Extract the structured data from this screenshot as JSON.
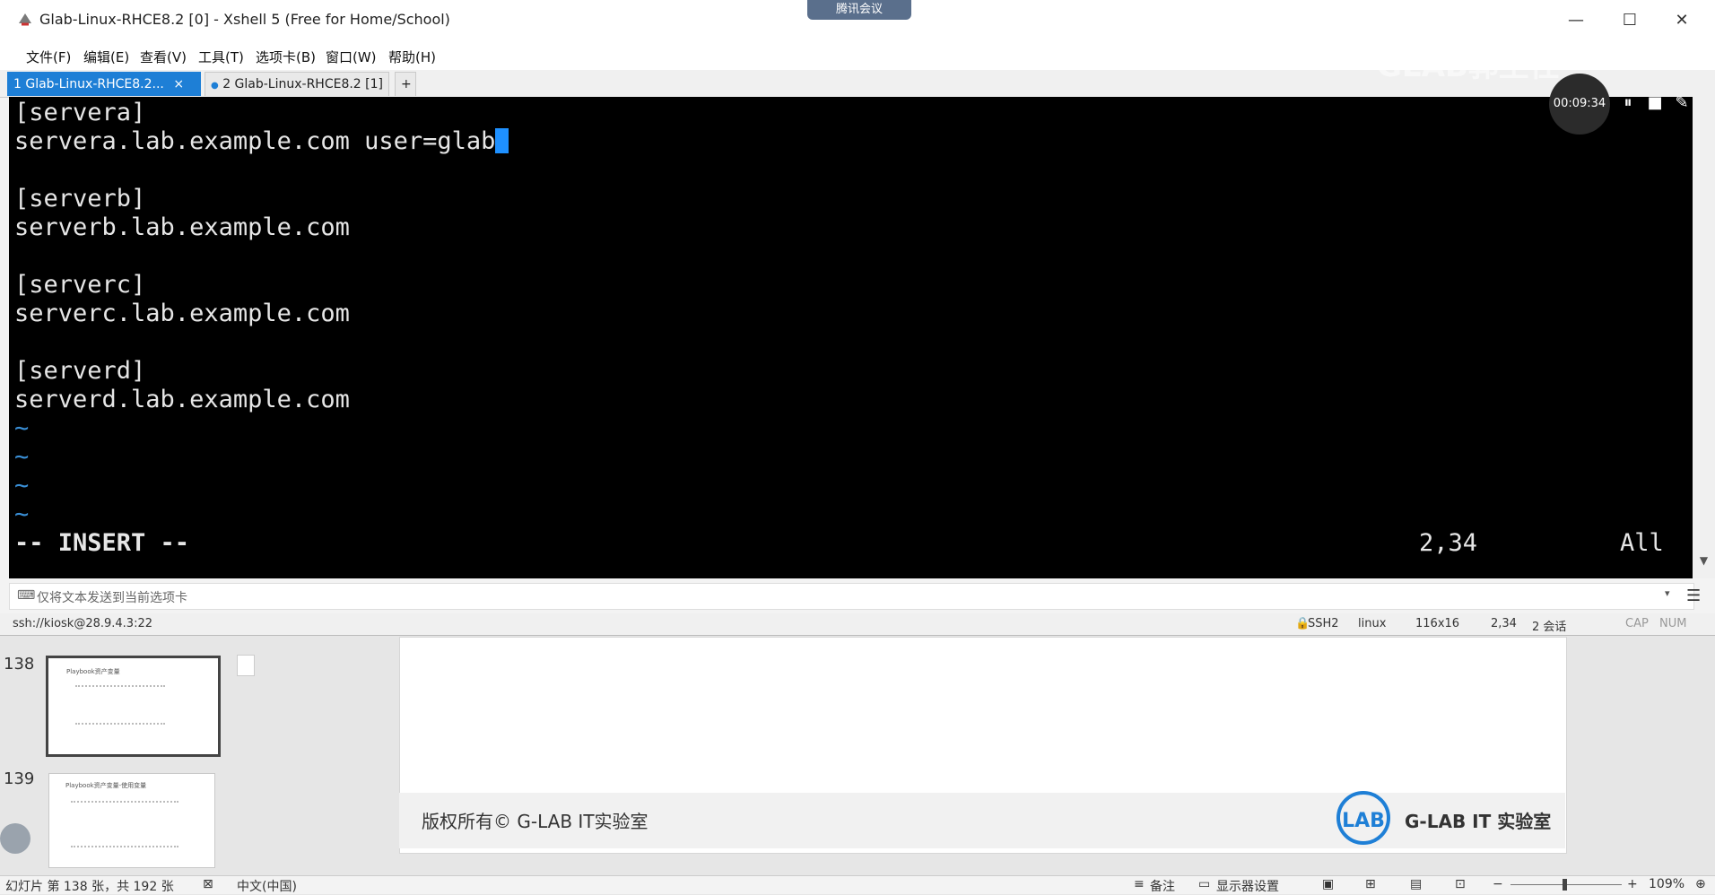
{
  "window": {
    "title": "Glab-Linux-RHCE8.2 [0] - Xshell 5 (Free for Home/School)",
    "meeting_label": "腾讯会议",
    "minimize": "—",
    "maximize": "☐",
    "close": "✕"
  },
  "menu": [
    "文件(F)",
    "编辑(E)",
    "查看(V)",
    "工具(T)",
    "选项卡(B)",
    "窗口(W)",
    "帮助(H)"
  ],
  "tabs": [
    {
      "label": "1 Glab-Linux-RHCE8.2...",
      "close": "×",
      "active": true
    },
    {
      "label": "2 Glab-Linux-RHCE8.2 [1]",
      "close": "×",
      "active": false
    }
  ],
  "new_tab": "+",
  "terminal": {
    "lines": [
      "[servera]",
      "servera.lab.example.com user=glab",
      "",
      "[serverb]",
      "serverb.lab.example.com",
      "",
      "[serverc]",
      "serverc.lab.example.com",
      "",
      "[serverd]",
      "serverd.lab.example.com"
    ],
    "tildes": [
      "~",
      "~",
      "~",
      "~"
    ],
    "mode": "-- INSERT --",
    "position": "2,34",
    "scroll": "All"
  },
  "recording": {
    "time": "00:09:34",
    "pause_icon": "⏸",
    "stop_icon": "■",
    "edit_icon": "✎"
  },
  "watermark": "GLAB郭主任",
  "send_bar": {
    "placeholder": "仅将文本发送到当前选项卡"
  },
  "status": {
    "ssh": "ssh://kiosk@28.9.4.3:22",
    "protocol": "SSH2",
    "term": "linux",
    "size": "116x16",
    "cursor": "2,34",
    "sessions": "2 会话",
    "cap": "CAP",
    "num": "NUM"
  },
  "slides": {
    "thumbs": [
      {
        "num": "138",
        "title": "Playbook资产变量"
      },
      {
        "num": "139",
        "title": "Playbook资产变量-使用变量"
      }
    ],
    "copyright": "版权所有© G-LAB IT实验室",
    "logo_text": "LAB",
    "brand": "G-LAB IT 实验室"
  },
  "ppt_status": {
    "slide_info": "幻灯片 第 138 张，共 192 张",
    "language": "中文(中国)",
    "notes": "备注",
    "display": "显示器设置",
    "zoom": "109%",
    "zoom_minus": "−",
    "zoom_plus": "+"
  }
}
